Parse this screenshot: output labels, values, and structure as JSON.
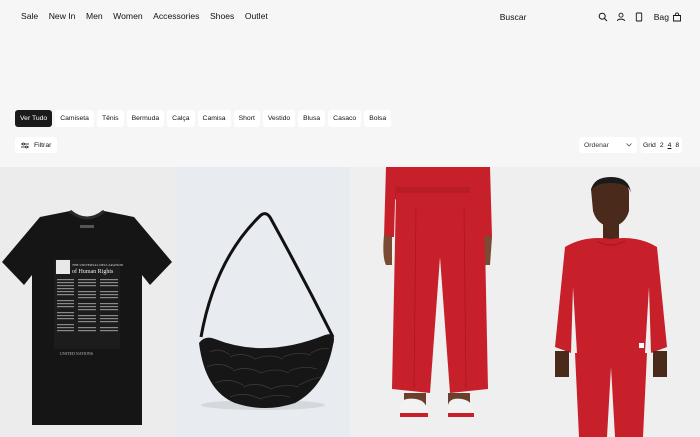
{
  "nav": {
    "links": [
      "Sale",
      "New In",
      "Men",
      "Women",
      "Accessories",
      "Shoes",
      "Outlet"
    ]
  },
  "header": {
    "search_placeholder": "Buscar",
    "bag_label": "Bag"
  },
  "categories": {
    "active_index": 0,
    "items": [
      "Ver Tudo",
      "Camiseta",
      "Tênis",
      "Bermuda",
      "Calça",
      "Camisa",
      "Short",
      "Vestido",
      "Blusa",
      "Casaco",
      "Bolsa"
    ]
  },
  "toolbar": {
    "filter_label": "Filtrar",
    "sort_label": "Ordenar",
    "grid_label": "Grid",
    "grid_options": [
      "2",
      "4",
      "8"
    ],
    "grid_active": "4"
  },
  "products": {
    "tshirt_print": {
      "line1": "THE UNIVERSAL DECLARATION",
      "line2": "of Human Rights",
      "footer": "UNITED NATIONS"
    }
  },
  "colors": {
    "accent": "#1a1a1a",
    "red": "#c8202a"
  }
}
